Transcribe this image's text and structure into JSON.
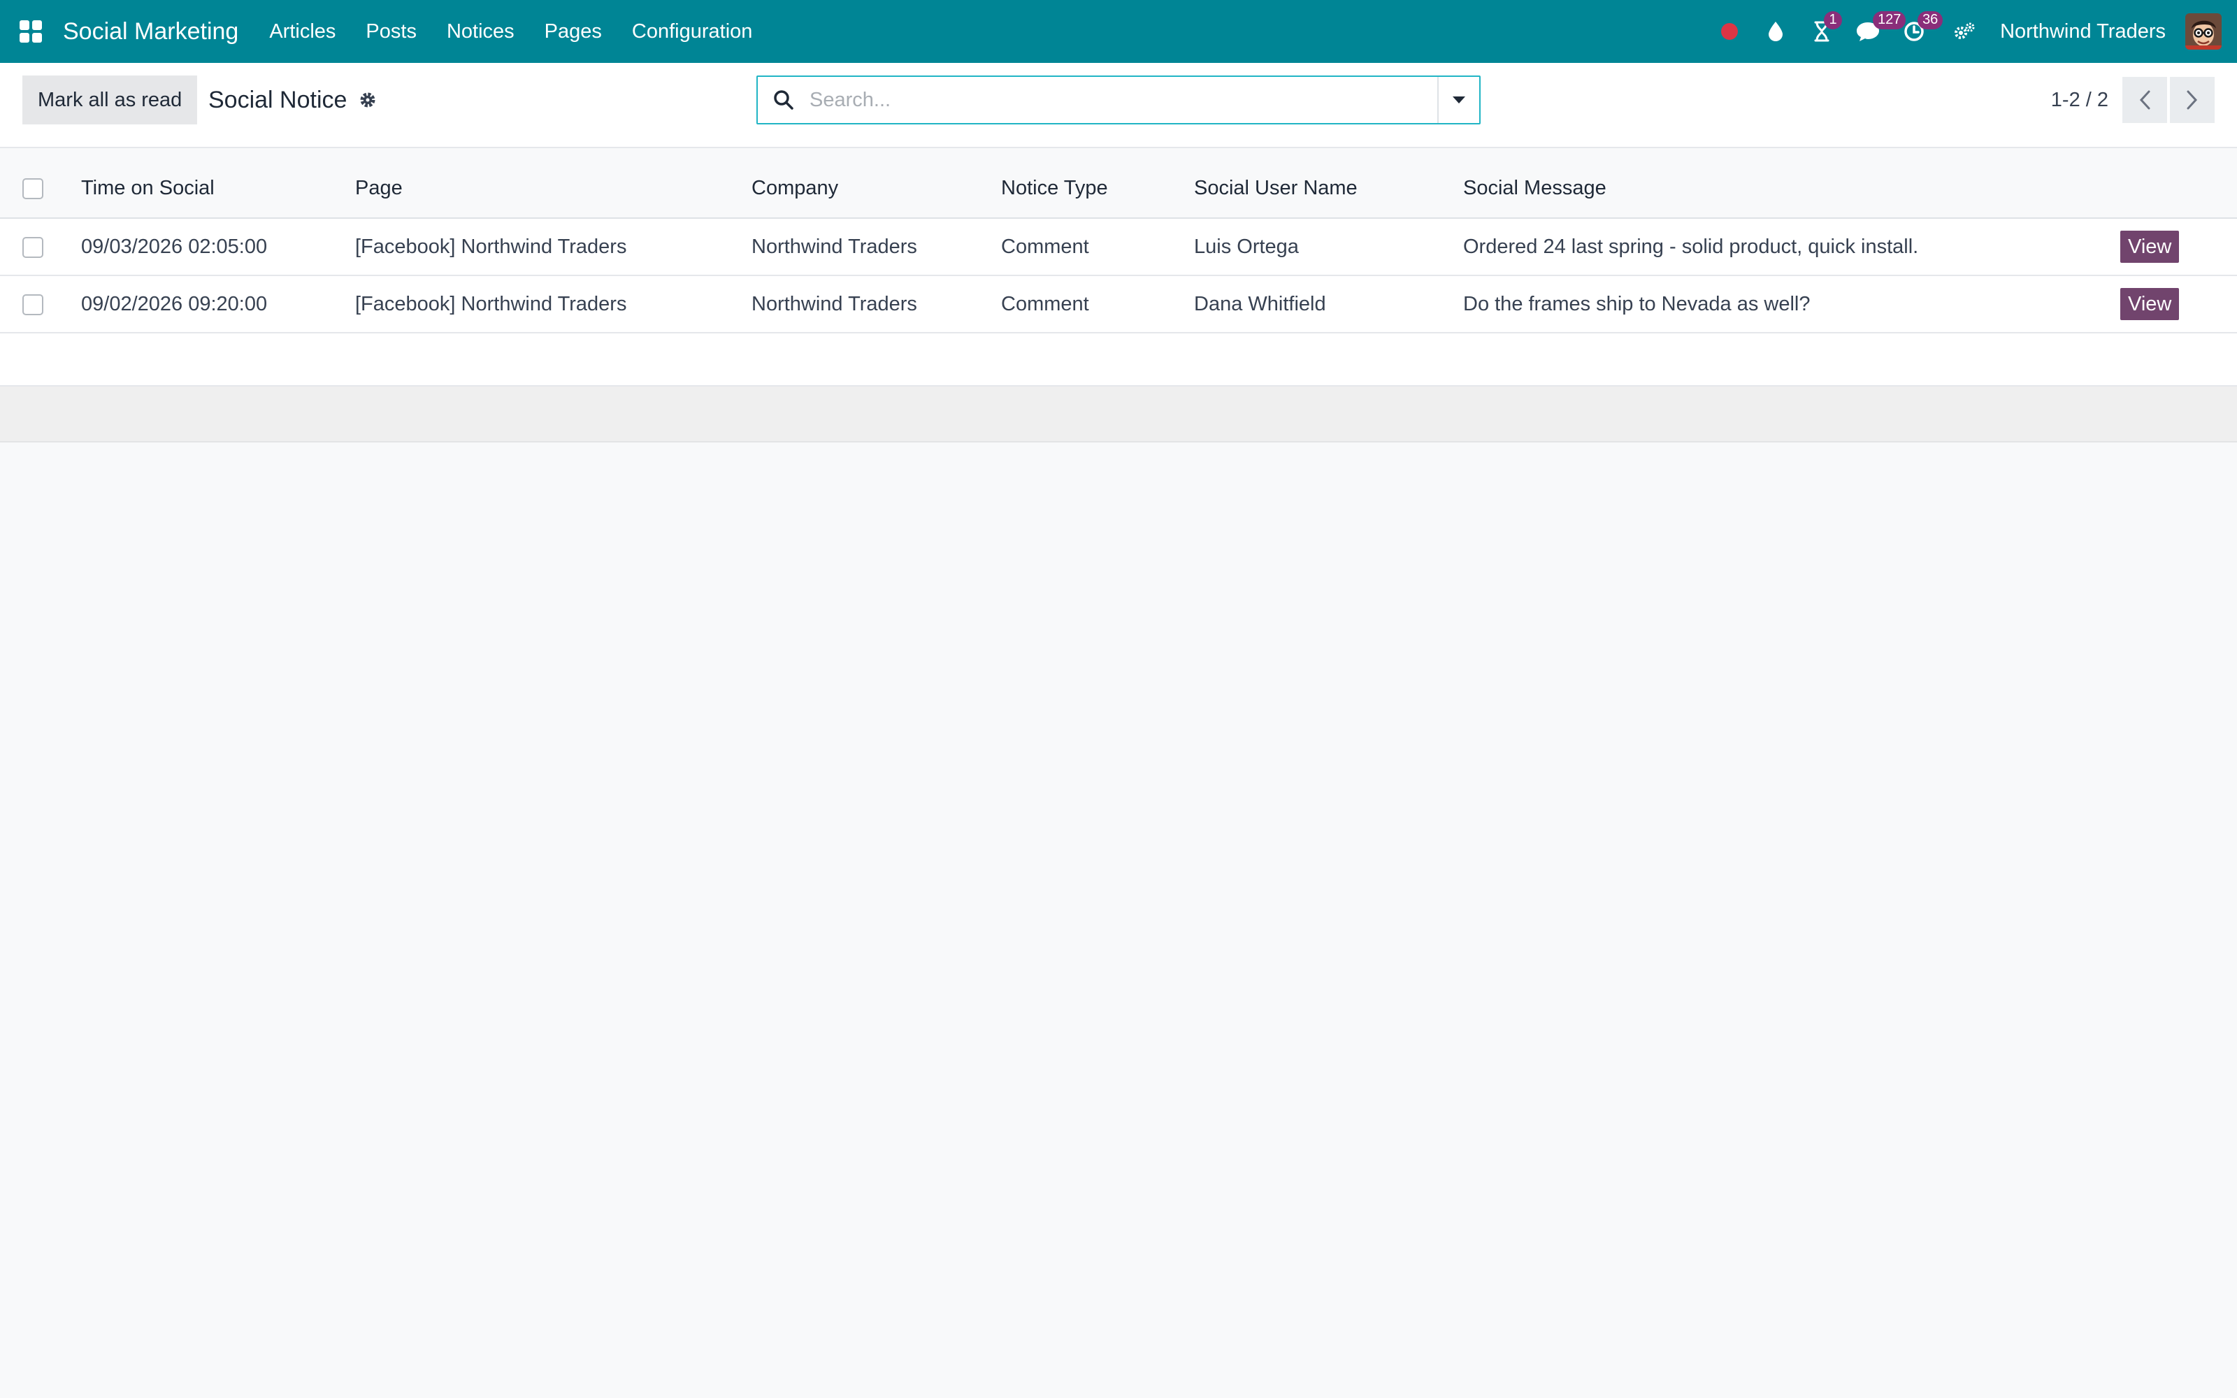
{
  "navbar": {
    "app_name": "Social Marketing",
    "menu": [
      "Articles",
      "Posts",
      "Notices",
      "Pages",
      "Configuration"
    ],
    "systray": {
      "activities_count": "1",
      "messages_count": "127",
      "clock_count": "36"
    },
    "company": "Northwind Traders",
    "accent_color": "#008595"
  },
  "control_panel": {
    "mark_all_label": "Mark all as read",
    "breadcrumb": "Social Notice",
    "search_placeholder": "Search...",
    "pager_value": "1-2 / 2"
  },
  "table": {
    "columns": [
      "Time on Social",
      "Page",
      "Company",
      "Notice Type",
      "Social User Name",
      "Social Message"
    ],
    "rows": [
      {
        "time": "09/03/2026 02:05:00",
        "page": "[Facebook] Northwind Traders",
        "company": "Northwind Traders",
        "notice_type": "Comment",
        "user_name": "Luis Ortega",
        "message": "Ordered 24 last spring - solid product, quick install.",
        "action_label": "View"
      },
      {
        "time": "09/02/2026 09:20:00",
        "page": "[Facebook] Northwind Traders",
        "company": "Northwind Traders",
        "notice_type": "Comment",
        "user_name": "Dana Whitfield",
        "message": "Do the frames ship to Nevada as well?",
        "action_label": "View"
      }
    ]
  },
  "icons": {
    "apps": "apps-grid-icon",
    "record": "record-dot-icon",
    "droplet": "droplet-icon",
    "hourglass": "hourglass-icon",
    "chat": "chat-icon",
    "clock": "clock-icon",
    "settings": "gears-icon",
    "search": "search-icon",
    "caret": "caret-down-icon",
    "prev": "chevron-left-icon",
    "next": "chevron-right-icon"
  },
  "colors": {
    "view_button": "#71446d",
    "badge": "#8a2e7a",
    "record": "#dc3545",
    "search_border": "#21b5c5"
  }
}
